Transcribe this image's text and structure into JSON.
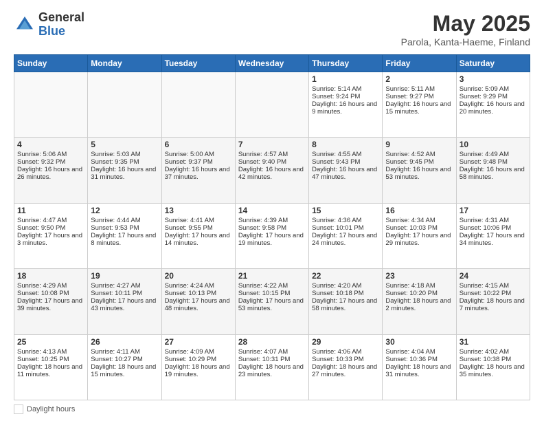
{
  "header": {
    "logo_general": "General",
    "logo_blue": "Blue",
    "month_title": "May 2025",
    "location": "Parola, Kanta-Haeme, Finland"
  },
  "weekdays": [
    "Sunday",
    "Monday",
    "Tuesday",
    "Wednesday",
    "Thursday",
    "Friday",
    "Saturday"
  ],
  "legend": {
    "daylight_label": "Daylight hours"
  },
  "weeks": [
    [
      {
        "day": "",
        "info": ""
      },
      {
        "day": "",
        "info": ""
      },
      {
        "day": "",
        "info": ""
      },
      {
        "day": "",
        "info": ""
      },
      {
        "day": "1",
        "info": "Sunrise: 5:14 AM\nSunset: 9:24 PM\nDaylight: 16 hours and 9 minutes."
      },
      {
        "day": "2",
        "info": "Sunrise: 5:11 AM\nSunset: 9:27 PM\nDaylight: 16 hours and 15 minutes."
      },
      {
        "day": "3",
        "info": "Sunrise: 5:09 AM\nSunset: 9:29 PM\nDaylight: 16 hours and 20 minutes."
      }
    ],
    [
      {
        "day": "4",
        "info": "Sunrise: 5:06 AM\nSunset: 9:32 PM\nDaylight: 16 hours and 26 minutes."
      },
      {
        "day": "5",
        "info": "Sunrise: 5:03 AM\nSunset: 9:35 PM\nDaylight: 16 hours and 31 minutes."
      },
      {
        "day": "6",
        "info": "Sunrise: 5:00 AM\nSunset: 9:37 PM\nDaylight: 16 hours and 37 minutes."
      },
      {
        "day": "7",
        "info": "Sunrise: 4:57 AM\nSunset: 9:40 PM\nDaylight: 16 hours and 42 minutes."
      },
      {
        "day": "8",
        "info": "Sunrise: 4:55 AM\nSunset: 9:43 PM\nDaylight: 16 hours and 47 minutes."
      },
      {
        "day": "9",
        "info": "Sunrise: 4:52 AM\nSunset: 9:45 PM\nDaylight: 16 hours and 53 minutes."
      },
      {
        "day": "10",
        "info": "Sunrise: 4:49 AM\nSunset: 9:48 PM\nDaylight: 16 hours and 58 minutes."
      }
    ],
    [
      {
        "day": "11",
        "info": "Sunrise: 4:47 AM\nSunset: 9:50 PM\nDaylight: 17 hours and 3 minutes."
      },
      {
        "day": "12",
        "info": "Sunrise: 4:44 AM\nSunset: 9:53 PM\nDaylight: 17 hours and 8 minutes."
      },
      {
        "day": "13",
        "info": "Sunrise: 4:41 AM\nSunset: 9:55 PM\nDaylight: 17 hours and 14 minutes."
      },
      {
        "day": "14",
        "info": "Sunrise: 4:39 AM\nSunset: 9:58 PM\nDaylight: 17 hours and 19 minutes."
      },
      {
        "day": "15",
        "info": "Sunrise: 4:36 AM\nSunset: 10:01 PM\nDaylight: 17 hours and 24 minutes."
      },
      {
        "day": "16",
        "info": "Sunrise: 4:34 AM\nSunset: 10:03 PM\nDaylight: 17 hours and 29 minutes."
      },
      {
        "day": "17",
        "info": "Sunrise: 4:31 AM\nSunset: 10:06 PM\nDaylight: 17 hours and 34 minutes."
      }
    ],
    [
      {
        "day": "18",
        "info": "Sunrise: 4:29 AM\nSunset: 10:08 PM\nDaylight: 17 hours and 39 minutes."
      },
      {
        "day": "19",
        "info": "Sunrise: 4:27 AM\nSunset: 10:11 PM\nDaylight: 17 hours and 43 minutes."
      },
      {
        "day": "20",
        "info": "Sunrise: 4:24 AM\nSunset: 10:13 PM\nDaylight: 17 hours and 48 minutes."
      },
      {
        "day": "21",
        "info": "Sunrise: 4:22 AM\nSunset: 10:15 PM\nDaylight: 17 hours and 53 minutes."
      },
      {
        "day": "22",
        "info": "Sunrise: 4:20 AM\nSunset: 10:18 PM\nDaylight: 17 hours and 58 minutes."
      },
      {
        "day": "23",
        "info": "Sunrise: 4:18 AM\nSunset: 10:20 PM\nDaylight: 18 hours and 2 minutes."
      },
      {
        "day": "24",
        "info": "Sunrise: 4:15 AM\nSunset: 10:22 PM\nDaylight: 18 hours and 7 minutes."
      }
    ],
    [
      {
        "day": "25",
        "info": "Sunrise: 4:13 AM\nSunset: 10:25 PM\nDaylight: 18 hours and 11 minutes."
      },
      {
        "day": "26",
        "info": "Sunrise: 4:11 AM\nSunset: 10:27 PM\nDaylight: 18 hours and 15 minutes."
      },
      {
        "day": "27",
        "info": "Sunrise: 4:09 AM\nSunset: 10:29 PM\nDaylight: 18 hours and 19 minutes."
      },
      {
        "day": "28",
        "info": "Sunrise: 4:07 AM\nSunset: 10:31 PM\nDaylight: 18 hours and 23 minutes."
      },
      {
        "day": "29",
        "info": "Sunrise: 4:06 AM\nSunset: 10:33 PM\nDaylight: 18 hours and 27 minutes."
      },
      {
        "day": "30",
        "info": "Sunrise: 4:04 AM\nSunset: 10:36 PM\nDaylight: 18 hours and 31 minutes."
      },
      {
        "day": "31",
        "info": "Sunrise: 4:02 AM\nSunset: 10:38 PM\nDaylight: 18 hours and 35 minutes."
      }
    ]
  ]
}
